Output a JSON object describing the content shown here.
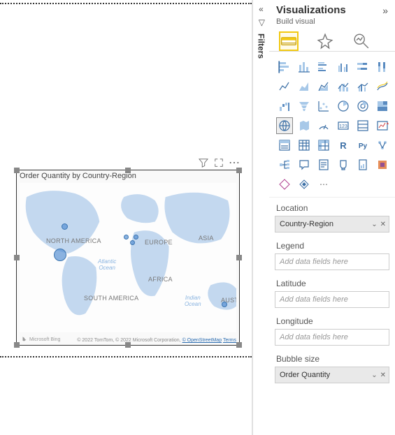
{
  "filters": {
    "label": "Filters"
  },
  "pane": {
    "title": "Visualizations",
    "subtitle": "Build visual"
  },
  "visual": {
    "title": "Order Quantity by Country-Region",
    "credit_prefix": "Microsoft Bing",
    "attrib_copyright": "© 2022 TomTom, © 2022 Microsoft Corporation,",
    "attrib_link1": "© OpenStreetMap",
    "attrib_link2": "Terms",
    "continents": {
      "na": "NORTH AMERICA",
      "sa": "SOUTH AMERICA",
      "eu": "EUROPE",
      "af": "AFRICA",
      "as": "ASIA",
      "au": "AUSTR"
    },
    "oceans": {
      "atlantic1": "Atlantic",
      "atlantic2": "Ocean",
      "indian1": "Indian",
      "indian2": "Ocean"
    }
  },
  "fields": {
    "location": {
      "label": "Location",
      "value": "Country-Region"
    },
    "legend": {
      "label": "Legend",
      "placeholder": "Add data fields here"
    },
    "latitude": {
      "label": "Latitude",
      "placeholder": "Add data fields here"
    },
    "longitude": {
      "label": "Longitude",
      "placeholder": "Add data fields here"
    },
    "bubble": {
      "label": "Bubble size",
      "value": "Order Quantity"
    }
  }
}
